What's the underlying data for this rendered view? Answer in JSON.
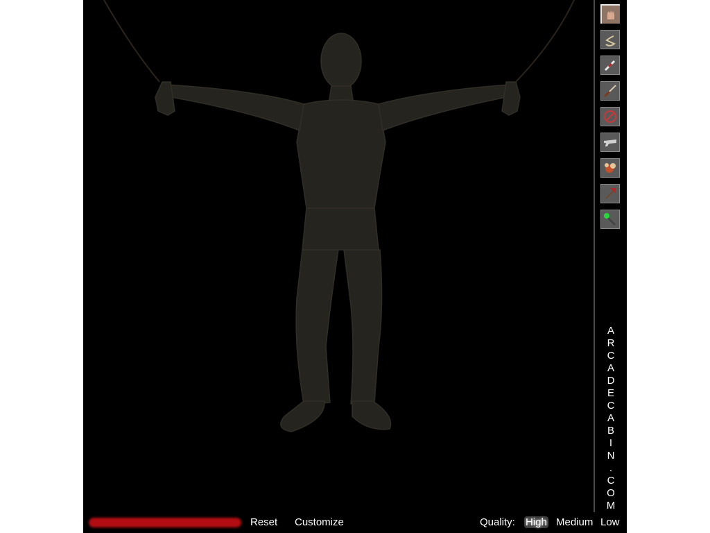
{
  "scene": {
    "subject": "figure-suspended-by-ropes",
    "background_color": "#000000",
    "figure_color": "#2a2823"
  },
  "toolbar": {
    "items": [
      {
        "name": "hand-tool",
        "icon": "hand-icon",
        "selected": true
      },
      {
        "name": "snake-tool",
        "icon": "snake-icon",
        "selected": false
      },
      {
        "name": "syringe-tool",
        "icon": "syringe-icon",
        "selected": false
      },
      {
        "name": "knife-tool",
        "icon": "knife-icon",
        "selected": false
      },
      {
        "name": "ban-tool",
        "icon": "no-symbol-icon",
        "selected": false
      },
      {
        "name": "gun-tool",
        "icon": "gun-icon",
        "selected": false
      },
      {
        "name": "explosive-tool",
        "icon": "explosion-icon",
        "selected": false
      },
      {
        "name": "axe-tool",
        "icon": "axe-icon",
        "selected": false
      },
      {
        "name": "wand-tool",
        "icon": "green-wand-icon",
        "selected": false
      }
    ]
  },
  "brand": {
    "letters": [
      "A",
      "R",
      "C",
      "A",
      "D",
      "E",
      "C",
      "A",
      "B",
      "I",
      "N",
      ".",
      "C",
      "O",
      "M"
    ]
  },
  "bottom_bar": {
    "health_bar_color": "#b10d12",
    "reset_label": "Reset",
    "customize_label": "Customize",
    "quality_label": "Quality:",
    "quality_options": [
      "High",
      "Medium",
      "Low"
    ],
    "quality_selected": "High"
  }
}
